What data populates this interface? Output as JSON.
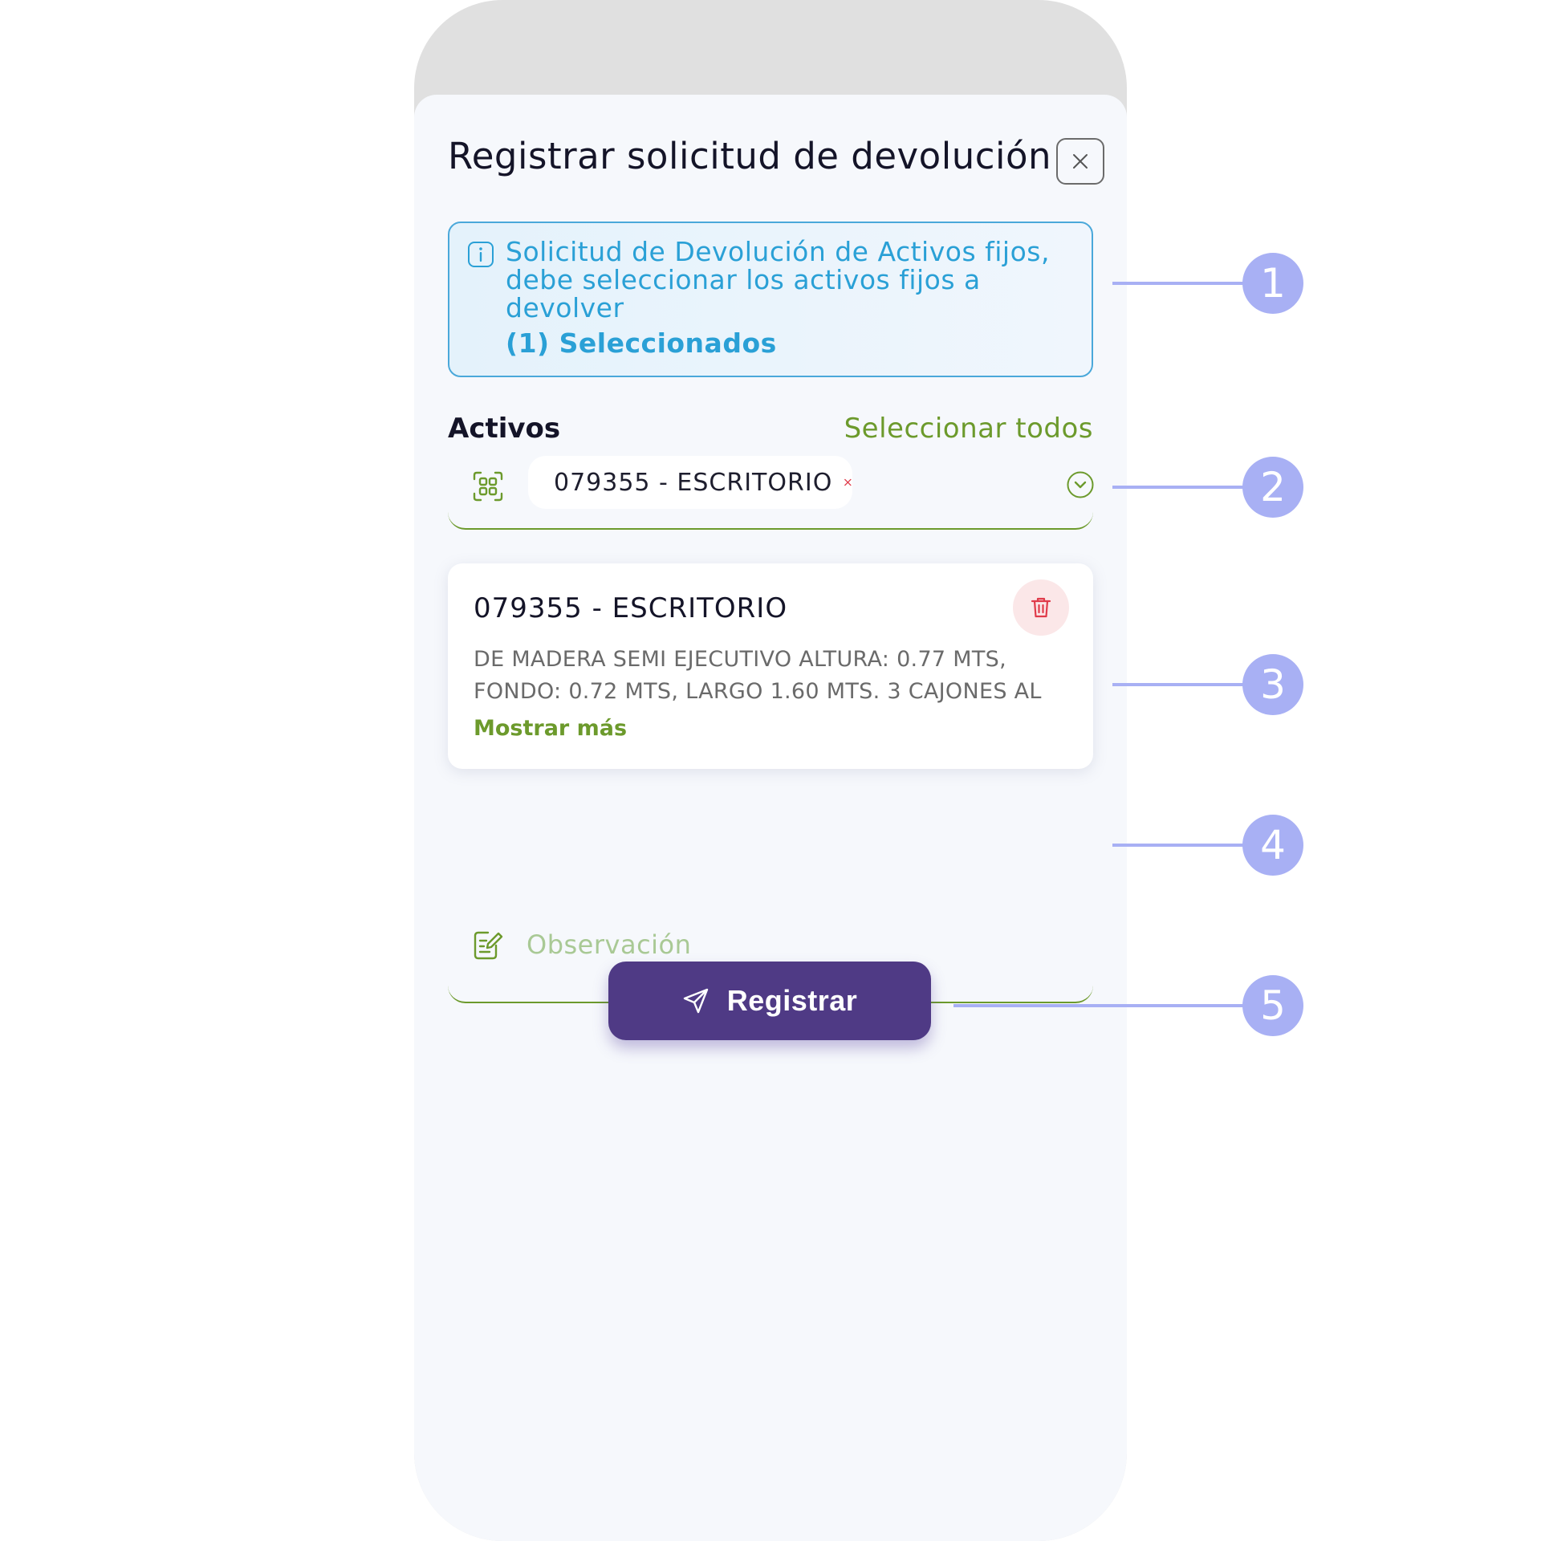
{
  "modal": {
    "title": "Registrar solicitud de devolución",
    "close_icon": "close-icon"
  },
  "info": {
    "icon": "info-icon",
    "message": "Solicitud de Devolución de Activos fijos, debe seleccionar los activos fijos a devolver",
    "selected_count": "(1) Seleccionados"
  },
  "assets": {
    "label": "Activos",
    "select_all": "Seleccionar todos",
    "scan_icon": "qr-scan-icon",
    "chips": [
      {
        "label": "079355 - ESCRITORIO"
      }
    ],
    "dropdown_icon": "chevron-down-icon"
  },
  "asset_card": {
    "title": "079355 - ESCRITORIO",
    "description": "DE MADERA SEMI EJECUTIVO ALTURA: 0.77 MTS, FONDO: 0.72 MTS, LARGO 1.60 MTS. 3 CAJONES AL LA...",
    "show_more": "Mostrar más",
    "delete_icon": "trash-icon"
  },
  "observation": {
    "placeholder": "Observación",
    "value": "",
    "icon": "edit-note-icon"
  },
  "submit": {
    "label": "Registrar",
    "icon": "send-icon"
  },
  "callouts": [
    "1",
    "2",
    "3",
    "4",
    "5"
  ],
  "colors": {
    "primary_purple": "#4f3a85",
    "accent_green": "#6c9a2c",
    "info_blue": "#2aa0d6",
    "danger_red": "#e03b4a",
    "callout": "#a8b0f4"
  }
}
